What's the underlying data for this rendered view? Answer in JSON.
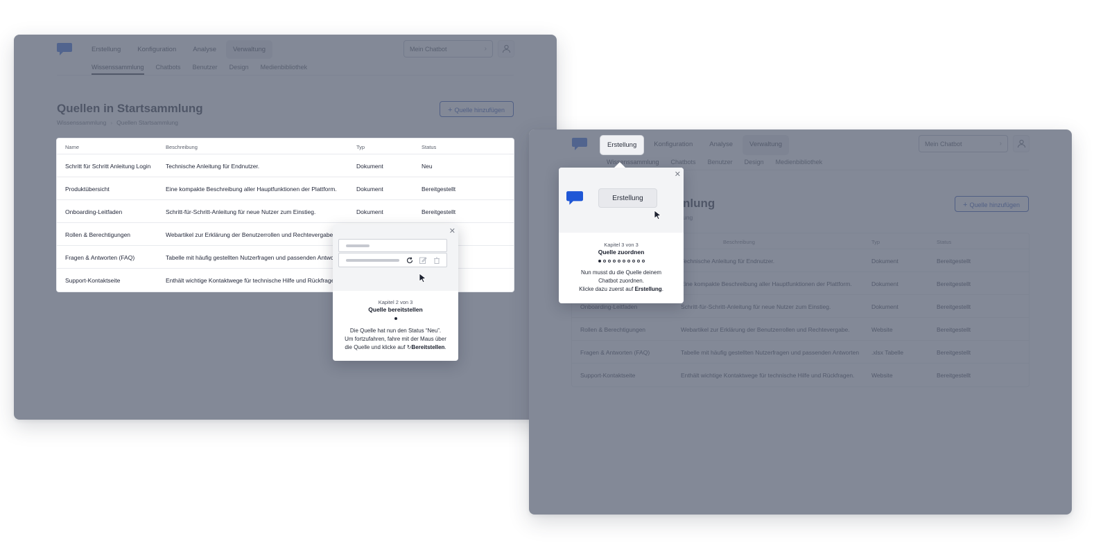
{
  "nav": {
    "items": [
      "Erstellung",
      "Konfiguration",
      "Analyse",
      "Verwaltung"
    ],
    "sub_items": [
      "Wissenssammlung",
      "Chatbots",
      "Benutzer",
      "Design",
      "Medienbibliothek"
    ],
    "chatbot_select": "Mein Chatbot"
  },
  "page": {
    "title": "Quellen in Startsammlung",
    "title_partial": "nlung",
    "breadcrumb_root": "Wissenssammlung",
    "breadcrumb_current": "Quellen Startsammlung",
    "breadcrumb_partial": "ung",
    "add_button": "Quelle hinzufügen"
  },
  "table": {
    "headers": [
      "Name",
      "Beschreibung",
      "Typ",
      "Status"
    ],
    "rows_left": [
      {
        "name": "Schritt für Schritt Anleitung Login",
        "desc": "Technische Anleitung für Endnutzer.",
        "typ": "Dokument",
        "status": "Neu"
      },
      {
        "name": "Produktübersicht",
        "desc": "Eine kompakte Beschreibung aller Hauptfunktionen der Plattform.",
        "typ": "Dokument",
        "status": "Bereitgestellt"
      },
      {
        "name": "Onboarding-Leitfaden",
        "desc": "Schritt-für-Schritt-Anleitung für neue Nutzer zum Einstieg.",
        "typ": "Dokument",
        "status": "Bereitgestellt"
      },
      {
        "name": "Rollen & Berechtigungen",
        "desc": "Webartikel zur Erklärung der Benutzerrollen und Rechtevergabe.",
        "typ": "",
        "status": ""
      },
      {
        "name": "Fragen & Antworten (FAQ)",
        "desc": "Tabelle mit häufig gestellten Nutzerfragen und passenden Antwo",
        "typ": "",
        "status": ""
      },
      {
        "name": "Support-Kontaktseite",
        "desc": "Enthält wichtige Kontaktwege für technische Hilfe und Rückfrage",
        "typ": "",
        "status": ""
      }
    ],
    "rows_right": [
      {
        "name": "",
        "desc": "Technische Anleitung für Endnutzer.",
        "typ": "Dokument",
        "status": "Bereitgestellt"
      },
      {
        "name": "",
        "desc": "Eine kompakte Beschreibung aller Hauptfunktionen der Plattform.",
        "typ": "Dokument",
        "status": "Bereitgestellt"
      },
      {
        "name": "Onboarding-Leitfaden",
        "desc": "Schritt-für-Schritt-Anleitung für neue Nutzer zum Einstieg.",
        "typ": "Dokument",
        "status": "Bereitgestellt"
      },
      {
        "name": "Rollen & Berechtigungen",
        "desc": "Webartikel zur Erklärung der Benutzerrollen und Rechtevergabe.",
        "typ": "Website",
        "status": "Bereitgestellt"
      },
      {
        "name": "Fragen & Antworten (FAQ)",
        "desc": "Tabelle mit häufig gestellten Nutzerfragen und passenden Antworten",
        "typ": ".xlsx Tabelle",
        "status": "Bereitgestellt"
      },
      {
        "name": "Support-Kontaktseite",
        "desc": "Enthält wichtige Kontaktwege für technische Hilfe und Rückfragen.",
        "typ": "Website",
        "status": "Bereitgestellt"
      }
    ],
    "header_desc_partial": "Beschreibung"
  },
  "popover1": {
    "chapter": "Kapitel 2 von 3",
    "title": "Quelle bereitstellen",
    "line1": "Die Quelle hat nun den Status “Neu”.",
    "line2": "Um fortzufahren, fahre mit der Maus über",
    "line3": "die Quelle und klicke auf",
    "action": "Bereitstellen",
    "period": "."
  },
  "popover2": {
    "chapter": "Kapitel 3 von 3",
    "title": "Quelle zuordnen",
    "mock_button": "Erstellung",
    "line1": "Nun musst du die Quelle deinem",
    "line2": "Chatbot zuordnen.",
    "line3": "Klicke dazu zuerst auf",
    "action": "Erstellung",
    "period": "."
  },
  "colors": {
    "accent": "#1a3fa8",
    "logo": "#1f57d6",
    "overlay": "#60687a"
  },
  "icons": [
    "chat-logo-icon",
    "user-icon",
    "chevron-right-icon",
    "plus-icon",
    "close-icon",
    "refresh-icon",
    "edit-icon",
    "trash-icon",
    "cursor-icon"
  ]
}
